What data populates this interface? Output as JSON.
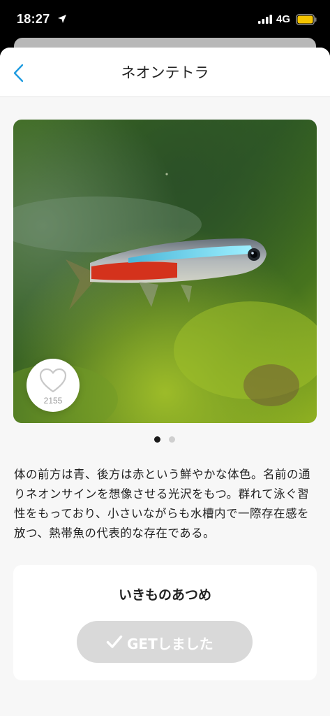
{
  "status_bar": {
    "time": "18:27",
    "location_icon": "location-arrow-icon",
    "signal_icon": "cellular-signal-icon",
    "network": "4G",
    "battery_icon": "battery-icon",
    "battery_color": "#f5c400"
  },
  "nav": {
    "back_icon": "chevron-left-icon",
    "title": "ネオンテトラ",
    "accent_color": "#1e9be0"
  },
  "photo": {
    "subject": "neon-tetra-photo",
    "like_icon": "heart-outline-icon",
    "like_count": "2155",
    "pager": {
      "total": 2,
      "current": 1
    }
  },
  "description": "体の前方は青、後方は赤という鮮やかな体色。名前の通りネオンサインを想像させる光沢をもつ。群れて泳ぐ習性をもっており、小さいながらも水槽内で一際存在感を放つ、熱帯魚の代表的な存在である。",
  "collection": {
    "title": "いきものあつめ",
    "button_icon": "checkmark-icon",
    "button_label": "GETしました"
  }
}
